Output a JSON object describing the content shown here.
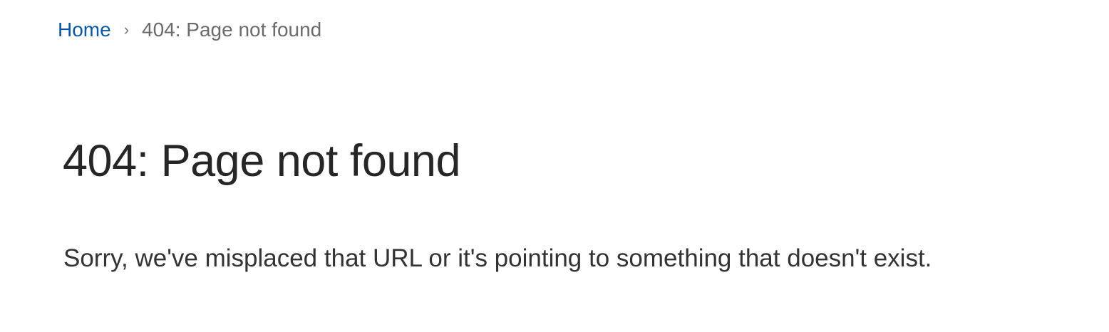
{
  "breadcrumb": {
    "home_label": "Home",
    "separator": "›",
    "current_label": "404: Page not found"
  },
  "main": {
    "title": "404: Page not found",
    "message": "Sorry, we've misplaced that URL or it's pointing to something that doesn't exist."
  },
  "colors": {
    "link": "#0b57a3",
    "breadcrumb_current": "#6b6b6b",
    "title": "#262626",
    "body_text": "#333333",
    "background": "#ffffff"
  }
}
